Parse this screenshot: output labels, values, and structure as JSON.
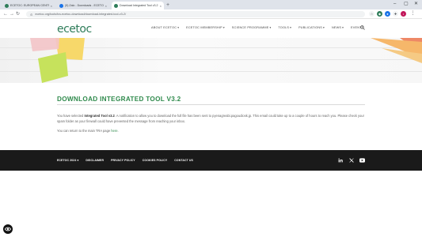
{
  "browser": {
    "tabs": [
      {
        "label": "ECETOC: EUROPEAN CENTRE FOR ECOTOX",
        "fav_color": "#2f7d5a",
        "active": false
      },
      {
        "label": "(5) Zalo - Downloads - ECETOC",
        "fav_color": "#1a73e8",
        "active": false
      },
      {
        "label": "Download Integrated Tool v3.2",
        "fav_color": "#2f7d5a",
        "active": true
      }
    ],
    "new_tab": "+",
    "tab_close": "×",
    "url": "ecetoc.org/tools/tra-ecetoc-download/download-integrated-tool-v3-2/",
    "window_controls": {
      "minimize": "–",
      "maximize": "▢",
      "close": "✕"
    },
    "nav_icons": {
      "back": "←",
      "forward": "→",
      "reload": "↻",
      "home": "⌂"
    }
  },
  "site": {
    "logo": "ecetoc",
    "nav": [
      {
        "label": "ABOUT ECETOC",
        "has_menu": true
      },
      {
        "label": "ECETOC MEMBERSHIP",
        "has_menu": true
      },
      {
        "label": "SCIENCE PROGRAMME",
        "has_menu": true
      },
      {
        "label": "TOOLS",
        "has_menu": true
      },
      {
        "label": "PUBLICATIONS",
        "has_menu": true
      },
      {
        "label": "NEWS",
        "has_menu": true
      },
      {
        "label": "EVENTS",
        "has_menu": false
      }
    ],
    "caret": "▾",
    "accent": "#2f8a4c"
  },
  "content": {
    "title": "DOWNLOAD INTEGRATED TOOL V3.2",
    "p1_pre": "You have selected ",
    "p1_bold": "Integrated Tool v3.2",
    "p1_post": ". A notification to allow you to download the full file has been sent to pyenagreabi.pagoudiosk.jp. This email could take up to a couple of hours to reach you. Please check your spam folder as your firewall could have prevented the message from reaching your inbox.",
    "p2_pre": "You can return to the main TRA page ",
    "p2_link": "here",
    "p2_post": "."
  },
  "footer": {
    "items": [
      {
        "label": "ECETOC 2024",
        "has_menu": true
      },
      {
        "label": "DISCLAIMER",
        "has_menu": false
      },
      {
        "label": "PRIVACY POLICY",
        "has_menu": false
      },
      {
        "label": "COOKIES POLICY",
        "has_menu": false
      },
      {
        "label": "CONTACT US",
        "has_menu": false
      }
    ],
    "social": [
      "linkedin-icon",
      "x-icon",
      "youtube-icon"
    ]
  }
}
